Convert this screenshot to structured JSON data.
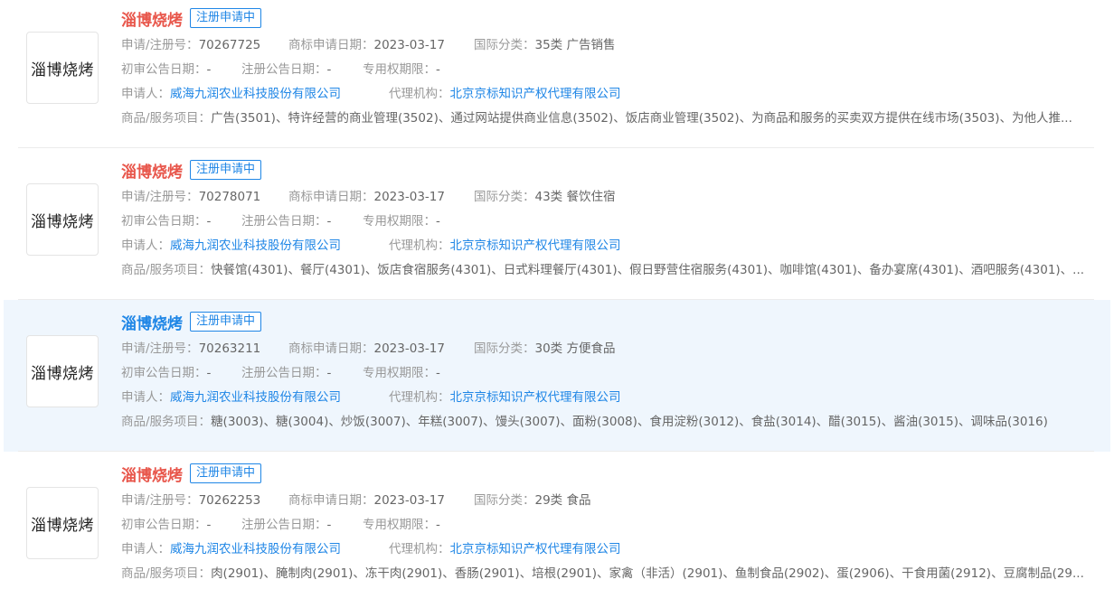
{
  "labels": {
    "reg_no": "申请/注册号：",
    "apply_date": "商标申请日期：",
    "intl_class": "国际分类：",
    "prelim_pub_date": "初审公告日期：",
    "reg_pub_date": "注册公告日期：",
    "exclusive_period": "专用权期限：",
    "applicant": "申请人：",
    "agency": "代理机构：",
    "goods": "商品/服务项目："
  },
  "items": [
    {
      "logo_text": "淄博烧烤",
      "name": "淄博烧烤",
      "status": "注册申请中",
      "reg_no": "70267725",
      "apply_date": "2023-03-17",
      "intl_class": "35类 广告销售",
      "prelim_pub_date": "-",
      "reg_pub_date": "-",
      "exclusive_period": "-",
      "applicant": "威海九润农业科技股份有限公司",
      "agency": "北京京标知识产权代理有限公司",
      "goods": "广告(3501)、特许经营的商业管理(3502)、通过网站提供商业信息(3502)、饭店商业管理(3502)、为商品和服务的买卖双方提供在线市场(3503)、为他人推..."
    },
    {
      "logo_text": "淄博烧烤",
      "name": "淄博烧烤",
      "status": "注册申请中",
      "reg_no": "70278071",
      "apply_date": "2023-03-17",
      "intl_class": "43类 餐饮住宿",
      "prelim_pub_date": "-",
      "reg_pub_date": "-",
      "exclusive_period": "-",
      "applicant": "威海九润农业科技股份有限公司",
      "agency": "北京京标知识产权代理有限公司",
      "goods": "快餐馆(4301)、餐厅(4301)、饭店食宿服务(4301)、日式料理餐厅(4301)、假日野营住宿服务(4301)、咖啡馆(4301)、备办宴席(4301)、酒吧服务(4301)、..."
    },
    {
      "logo_text": "淄博烧烤",
      "name": "淄博烧烤",
      "status": "注册申请中",
      "reg_no": "70263211",
      "apply_date": "2023-03-17",
      "intl_class": "30类 方便食品",
      "prelim_pub_date": "-",
      "reg_pub_date": "-",
      "exclusive_period": "-",
      "applicant": "威海九润农业科技股份有限公司",
      "agency": "北京京标知识产权代理有限公司",
      "goods": "糖(3003)、糖(3004)、炒饭(3007)、年糕(3007)、馒头(3007)、面粉(3008)、食用淀粉(3012)、食盐(3014)、醋(3015)、酱油(3015)、调味品(3016)"
    },
    {
      "logo_text": "淄博烧烤",
      "name": "淄博烧烤",
      "status": "注册申请中",
      "reg_no": "70262253",
      "apply_date": "2023-03-17",
      "intl_class": "29类 食品",
      "prelim_pub_date": "-",
      "reg_pub_date": "-",
      "exclusive_period": "-",
      "applicant": "威海九润农业科技股份有限公司",
      "agency": "北京京标知识产权代理有限公司",
      "goods": "肉(2901)、腌制肉(2901)、冻干肉(2901)、香肠(2901)、培根(2901)、家禽（非活）(2901)、鱼制食品(2902)、蛋(2906)、干食用菌(2912)、豆腐制品(29..."
    }
  ],
  "colors": {
    "title_red": "#e8564b",
    "link_blue": "#1f86e6",
    "hover_bg": "#eff6fd"
  }
}
